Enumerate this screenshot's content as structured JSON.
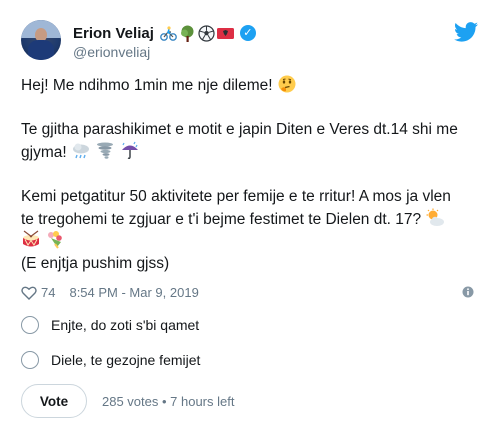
{
  "author": {
    "name": "Erion Veliaj",
    "handle": "@erionveliaj",
    "name_emojis": [
      "cyclist-icon",
      "tree-icon",
      "soccer-ball-icon",
      "albania-flag-icon"
    ],
    "verified": true
  },
  "tweet": {
    "line1": "Hej! Me ndihmo 1min me nje dileme!",
    "line2": "Te gjitha parashikimet e motit e japin Diten e Veres dt.14 shi me",
    "line3": "gjyma!",
    "line4": "Kemi petgatitur 50 aktivitete per femije e te rritur! A mos ja vlen",
    "line5": "te tregohemi te zgjuar e t'i bejme festimet te Dielen dt. 17?",
    "line6": "(E enjtja pushim gjss)"
  },
  "meta": {
    "likes": "74",
    "timestamp": "8:54 PM - Mar 9, 2019"
  },
  "poll": {
    "options": [
      "Enjte, do zoti s'bi qamet",
      "Diele, te gezojne femijet"
    ],
    "vote_label": "Vote",
    "info": "285 votes • 7 hours left"
  },
  "colors": {
    "accent": "#1da1f2",
    "text": "#14171a",
    "muted": "#657786",
    "border": "#ccd6dd"
  }
}
